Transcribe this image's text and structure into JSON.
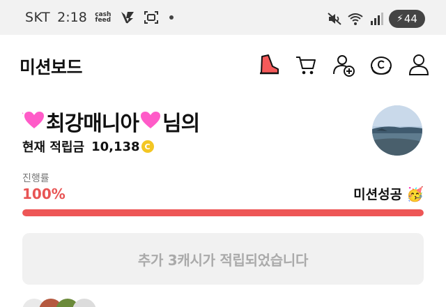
{
  "status_bar": {
    "carrier": "SKT",
    "time": "2:18",
    "app_badge_line1": "cash",
    "app_badge_line2": "feed",
    "battery_level": "44"
  },
  "header": {
    "title": "미션보드",
    "icons": [
      "shoe-icon",
      "cart-icon",
      "add-user-icon",
      "coin-c-icon",
      "profile-icon"
    ]
  },
  "profile": {
    "user_name": "최강매니아",
    "suffix": "님의",
    "balance_label": "현재 적립금",
    "balance_value": "10,138",
    "coin_symbol": "C"
  },
  "progress": {
    "label": "진행률",
    "value_text": "100%",
    "fraction": 1.0,
    "status_text": "미션성공",
    "status_emoji": "🥳"
  },
  "reward_button": {
    "label": "추가 3캐시가 적립되었습니다"
  },
  "colors": {
    "accent": "#ee5656",
    "coin": "#f3c623",
    "statusbar_bg": "#f2f2f2",
    "button_bg": "#f1f1f1",
    "heart": "#ff5bc8"
  }
}
